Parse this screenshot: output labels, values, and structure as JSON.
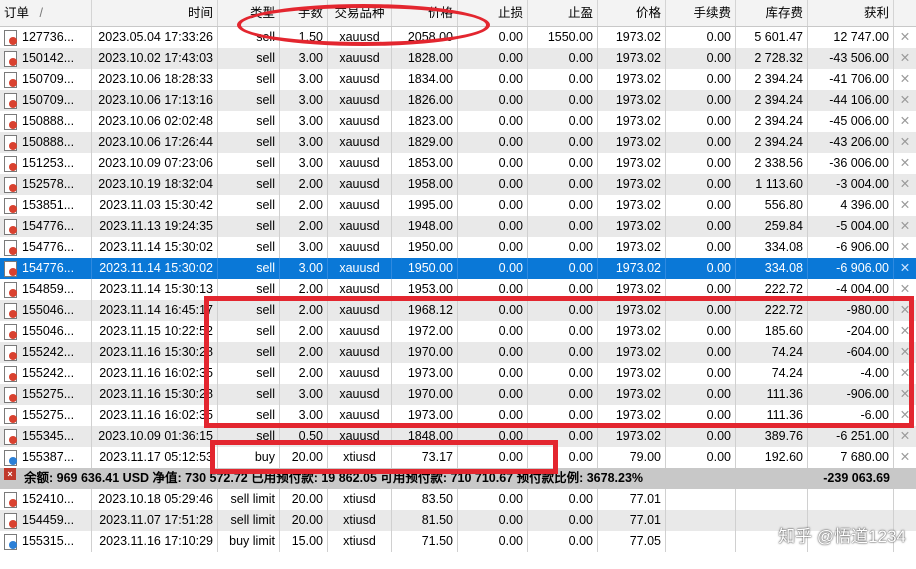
{
  "columns": {
    "order": "订单",
    "sort": "/",
    "time": "时间",
    "type": "类型",
    "volume": "手数",
    "symbol": "交易品种",
    "price": "价格",
    "sl": "止损",
    "tp": "止盈",
    "current": "价格",
    "commission": "手续费",
    "swap": "库存费",
    "profit": "获利"
  },
  "positions": [
    {
      "order": "127736...",
      "time": "2023.05.04 17:33:26",
      "type": "sell",
      "volume": "1.50",
      "symbol": "xauusd",
      "price": "2058.00",
      "sl": "0.00",
      "tp": "1550.00",
      "current": "1973.02",
      "commission": "0.00",
      "swap": "5 601.47",
      "profit": "12 747.00",
      "icon": "sell"
    },
    {
      "order": "150142...",
      "time": "2023.10.02 17:43:03",
      "type": "sell",
      "volume": "3.00",
      "symbol": "xauusd",
      "price": "1828.00",
      "sl": "0.00",
      "tp": "0.00",
      "current": "1973.02",
      "commission": "0.00",
      "swap": "2 728.32",
      "profit": "-43 506.00",
      "icon": "sell"
    },
    {
      "order": "150709...",
      "time": "2023.10.06 18:28:33",
      "type": "sell",
      "volume": "3.00",
      "symbol": "xauusd",
      "price": "1834.00",
      "sl": "0.00",
      "tp": "0.00",
      "current": "1973.02",
      "commission": "0.00",
      "swap": "2 394.24",
      "profit": "-41 706.00",
      "icon": "sell"
    },
    {
      "order": "150709...",
      "time": "2023.10.06 17:13:16",
      "type": "sell",
      "volume": "3.00",
      "symbol": "xauusd",
      "price": "1826.00",
      "sl": "0.00",
      "tp": "0.00",
      "current": "1973.02",
      "commission": "0.00",
      "swap": "2 394.24",
      "profit": "-44 106.00",
      "icon": "sell"
    },
    {
      "order": "150888...",
      "time": "2023.10.06 02:02:48",
      "type": "sell",
      "volume": "3.00",
      "symbol": "xauusd",
      "price": "1823.00",
      "sl": "0.00",
      "tp": "0.00",
      "current": "1973.02",
      "commission": "0.00",
      "swap": "2 394.24",
      "profit": "-45 006.00",
      "icon": "sell"
    },
    {
      "order": "150888...",
      "time": "2023.10.06 17:26:44",
      "type": "sell",
      "volume": "3.00",
      "symbol": "xauusd",
      "price": "1829.00",
      "sl": "0.00",
      "tp": "0.00",
      "current": "1973.02",
      "commission": "0.00",
      "swap": "2 394.24",
      "profit": "-43 206.00",
      "icon": "sell"
    },
    {
      "order": "151253...",
      "time": "2023.10.09 07:23:06",
      "type": "sell",
      "volume": "3.00",
      "symbol": "xauusd",
      "price": "1853.00",
      "sl": "0.00",
      "tp": "0.00",
      "current": "1973.02",
      "commission": "0.00",
      "swap": "2 338.56",
      "profit": "-36 006.00",
      "icon": "sell"
    },
    {
      "order": "152578...",
      "time": "2023.10.19 18:32:04",
      "type": "sell",
      "volume": "2.00",
      "symbol": "xauusd",
      "price": "1958.00",
      "sl": "0.00",
      "tp": "0.00",
      "current": "1973.02",
      "commission": "0.00",
      "swap": "1 113.60",
      "profit": "-3 004.00",
      "icon": "sell"
    },
    {
      "order": "153851...",
      "time": "2023.11.03 15:30:42",
      "type": "sell",
      "volume": "2.00",
      "symbol": "xauusd",
      "price": "1995.00",
      "sl": "0.00",
      "tp": "0.00",
      "current": "1973.02",
      "commission": "0.00",
      "swap": "556.80",
      "profit": "4 396.00",
      "icon": "sell"
    },
    {
      "order": "154776...",
      "time": "2023.11.13 19:24:35",
      "type": "sell",
      "volume": "2.00",
      "symbol": "xauusd",
      "price": "1948.00",
      "sl": "0.00",
      "tp": "0.00",
      "current": "1973.02",
      "commission": "0.00",
      "swap": "259.84",
      "profit": "-5 004.00",
      "icon": "sell"
    },
    {
      "order": "154776...",
      "time": "2023.11.14 15:30:02",
      "type": "sell",
      "volume": "3.00",
      "symbol": "xauusd",
      "price": "1950.00",
      "sl": "0.00",
      "tp": "0.00",
      "current": "1973.02",
      "commission": "0.00",
      "swap": "334.08",
      "profit": "-6 906.00",
      "icon": "sell"
    },
    {
      "order": "154776...",
      "time": "2023.11.14 15:30:02",
      "type": "sell",
      "volume": "3.00",
      "symbol": "xauusd",
      "price": "1950.00",
      "sl": "0.00",
      "tp": "0.00",
      "current": "1973.02",
      "commission": "0.00",
      "swap": "334.08",
      "profit": "-6 906.00",
      "icon": "sell",
      "selected": true
    },
    {
      "order": "154859...",
      "time": "2023.11.14 15:30:13",
      "type": "sell",
      "volume": "2.00",
      "symbol": "xauusd",
      "price": "1953.00",
      "sl": "0.00",
      "tp": "0.00",
      "current": "1973.02",
      "commission": "0.00",
      "swap": "222.72",
      "profit": "-4 004.00",
      "icon": "sell"
    },
    {
      "order": "155046...",
      "time": "2023.11.14 16:45:17",
      "type": "sell",
      "volume": "2.00",
      "symbol": "xauusd",
      "price": "1968.12",
      "sl": "0.00",
      "tp": "0.00",
      "current": "1973.02",
      "commission": "0.00",
      "swap": "222.72",
      "profit": "-980.00",
      "icon": "sell"
    },
    {
      "order": "155046...",
      "time": "2023.11.15 10:22:52",
      "type": "sell",
      "volume": "2.00",
      "symbol": "xauusd",
      "price": "1972.00",
      "sl": "0.00",
      "tp": "0.00",
      "current": "1973.02",
      "commission": "0.00",
      "swap": "185.60",
      "profit": "-204.00",
      "icon": "sell"
    },
    {
      "order": "155242...",
      "time": "2023.11.16 15:30:28",
      "type": "sell",
      "volume": "2.00",
      "symbol": "xauusd",
      "price": "1970.00",
      "sl": "0.00",
      "tp": "0.00",
      "current": "1973.02",
      "commission": "0.00",
      "swap": "74.24",
      "profit": "-604.00",
      "icon": "sell"
    },
    {
      "order": "155242...",
      "time": "2023.11.16 16:02:35",
      "type": "sell",
      "volume": "2.00",
      "symbol": "xauusd",
      "price": "1973.00",
      "sl": "0.00",
      "tp": "0.00",
      "current": "1973.02",
      "commission": "0.00",
      "swap": "74.24",
      "profit": "-4.00",
      "icon": "sell"
    },
    {
      "order": "155275...",
      "time": "2023.11.16 15:30:28",
      "type": "sell",
      "volume": "3.00",
      "symbol": "xauusd",
      "price": "1970.00",
      "sl": "0.00",
      "tp": "0.00",
      "current": "1973.02",
      "commission": "0.00",
      "swap": "111.36",
      "profit": "-906.00",
      "icon": "sell"
    },
    {
      "order": "155275...",
      "time": "2023.11.16 16:02:35",
      "type": "sell",
      "volume": "3.00",
      "symbol": "xauusd",
      "price": "1973.00",
      "sl": "0.00",
      "tp": "0.00",
      "current": "1973.02",
      "commission": "0.00",
      "swap": "111.36",
      "profit": "-6.00",
      "icon": "sell"
    },
    {
      "order": "155345...",
      "time": "2023.10.09 01:36:15",
      "type": "sell",
      "volume": "0.50",
      "symbol": "xauusd",
      "price": "1848.00",
      "sl": "0.00",
      "tp": "0.00",
      "current": "1973.02",
      "commission": "0.00",
      "swap": "389.76",
      "profit": "-6 251.00",
      "icon": "sell"
    },
    {
      "order": "155387...",
      "time": "2023.11.17 05:12:53",
      "type": "buy",
      "volume": "20.00",
      "symbol": "xtiusd",
      "price": "73.17",
      "sl": "0.00",
      "tp": "0.00",
      "current": "79.00",
      "commission": "0.00",
      "swap": "192.60",
      "profit": "7 680.00",
      "icon": "buy"
    }
  ],
  "summary": {
    "text": "余额: 969 636.41 USD  净值: 730 572.72  已用预付款: 19 862.05  可用预付款: 710 710.67  预付款比例: 3678.23%",
    "profit": "-239 063.69",
    "icon": "×"
  },
  "orders": [
    {
      "order": "152410...",
      "time": "2023.10.18 05:29:46",
      "type": "sell limit",
      "volume": "20.00",
      "symbol": "xtiusd",
      "price": "83.50",
      "sl": "0.00",
      "tp": "0.00",
      "current": "77.01",
      "commission": "",
      "swap": "",
      "profit": "",
      "icon": "sell"
    },
    {
      "order": "154459...",
      "time": "2023.11.07 17:51:28",
      "type": "sell limit",
      "volume": "20.00",
      "symbol": "xtiusd",
      "price": "81.50",
      "sl": "0.00",
      "tp": "0.00",
      "current": "77.01",
      "commission": "",
      "swap": "",
      "profit": "",
      "icon": "sell"
    },
    {
      "order": "155315...",
      "time": "2023.11.16 17:10:29",
      "type": "buy limit",
      "volume": "15.00",
      "symbol": "xtiusd",
      "price": "71.50",
      "sl": "0.00",
      "tp": "0.00",
      "current": "77.05",
      "commission": "",
      "swap": "",
      "profit": "",
      "icon": "buy"
    }
  ],
  "close_glyph": "✕",
  "watermark": "知乎 @悟道1234",
  "colors": {
    "selection": "#0a78d7",
    "annotation": "#e3262f",
    "row_alt": "#e9e9e9",
    "sell_dot": "#d9412f",
    "buy_dot": "#2b7fd6"
  }
}
